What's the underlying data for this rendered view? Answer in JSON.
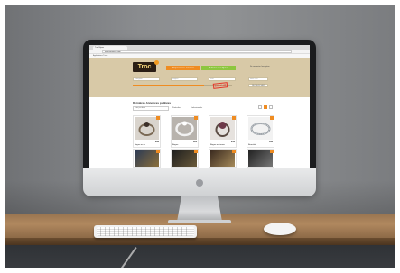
{
  "browser": {
    "tab_title": "Troc Bijoux",
    "address": "www.trocbijoux.com",
    "bookmarks": "Applications   Trocs"
  },
  "site": {
    "logo_text": "Troc",
    "nav": {
      "orange_label": "Déposer une annonce",
      "green_label": "Acheter des bijoux"
    },
    "top_links": "Se connecter   Inscription",
    "search": {
      "placeholders": [
        "Catégorie",
        "Région",
        "Ville",
        "Mots clés"
      ],
      "button": "RECHERCHER"
    },
    "stamp_text": "GRATUIT",
    "price_slider_level": 0.72
  },
  "content": {
    "section_title": "Dernières Annonces publiées",
    "filter_placeholder": "Trier par date",
    "radios": [
      "Particuliers",
      "Professionnels"
    ]
  },
  "listings": [
    {
      "title": "Bague en or",
      "price": "60€",
      "image": "ring"
    },
    {
      "title": "Bague",
      "price": "12€",
      "image": "ring-white"
    },
    {
      "title": "Bague ancienne",
      "price": "25€",
      "image": "ring-gem"
    },
    {
      "title": "Bracelet",
      "price": "50€",
      "image": "bracelet"
    }
  ],
  "second_row": [
    {
      "image": "watch"
    },
    {
      "image": "necklace"
    },
    {
      "image": "bag"
    },
    {
      "image": "earrings"
    }
  ],
  "colors": {
    "accent_orange": "#ef8c22",
    "accent_green": "#8dc63f",
    "header_bg": "#d8c9a7",
    "logo_bg": "#2a1e14"
  }
}
